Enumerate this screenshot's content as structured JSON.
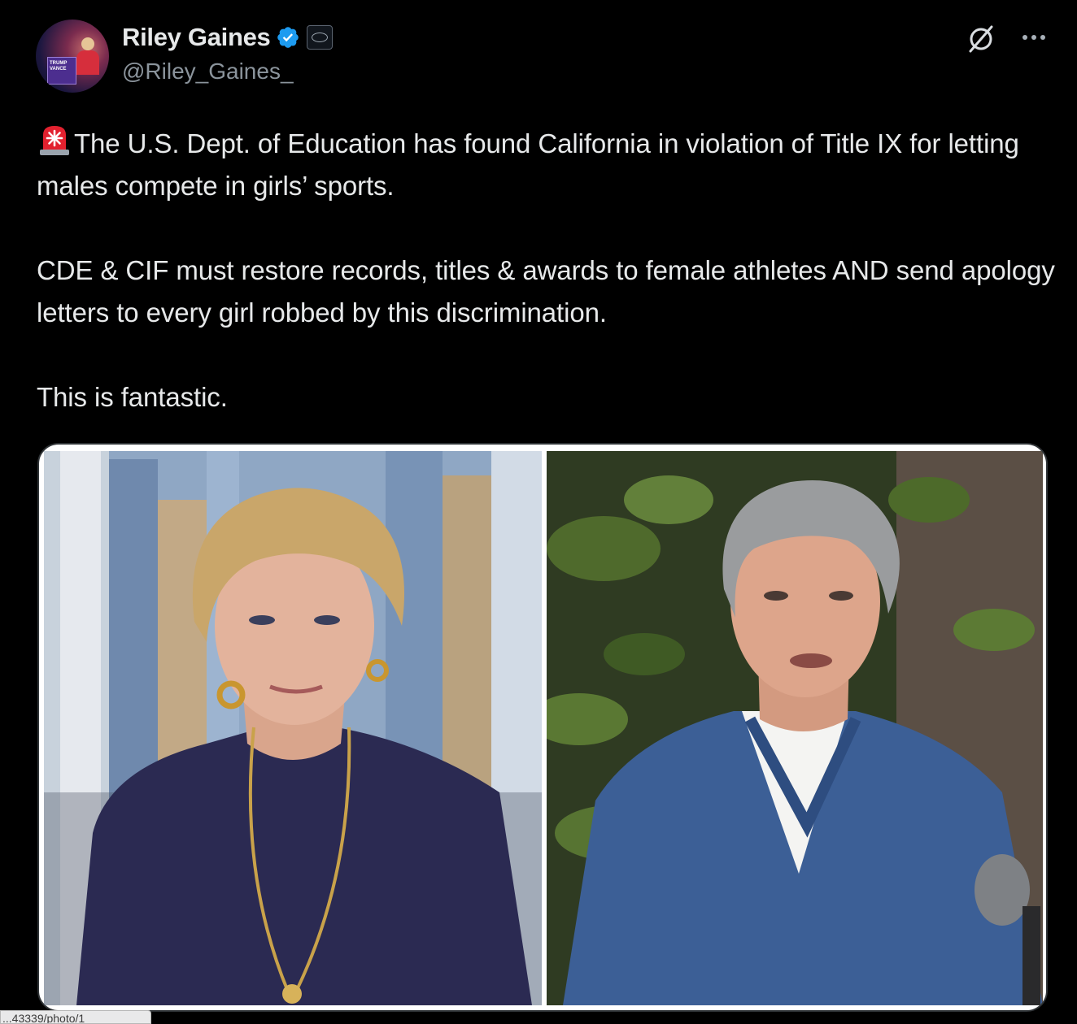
{
  "author": {
    "display_name": "Riley Gaines",
    "handle": "@Riley_Gaines_",
    "avatar_podium_text": "TRUMP VANCE"
  },
  "icons": {
    "verified": "verified-badge-icon",
    "affiliation": "affiliate-badge-icon",
    "grok": "grok-icon",
    "more": "more-options-icon",
    "siren": "siren-emoji-icon"
  },
  "tweet": {
    "para1": "The U.S. Dept. of Education has found California in violation of Title IX for letting males compete in girls’ sports.",
    "para2": "CDE & CIF must restore records, titles & awards to female athletes AND send apology letters to every girl robbed by this discrimination.",
    "para3": "This is fantastic."
  },
  "media": {
    "photos": [
      "left-photo",
      "right-photo"
    ]
  },
  "status_bar": {
    "url": "...43339/photo/1"
  },
  "colors": {
    "background": "#000000",
    "text": "#e7e9ea",
    "secondary_text": "#8b949c",
    "verified_blue": "#1d9bf0"
  }
}
